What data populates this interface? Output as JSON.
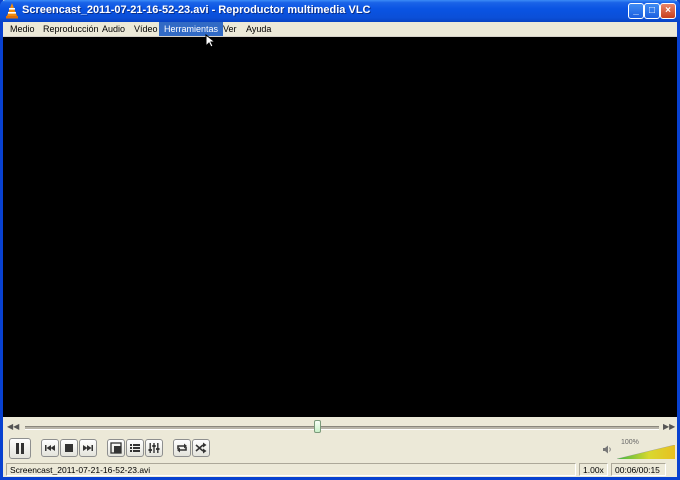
{
  "window": {
    "title": "Screencast_2011-07-21-16-52-23.avi - Reproductor multimedia VLC",
    "controls": {
      "minimize": "_",
      "maximize": "□",
      "close": "×"
    }
  },
  "menu": {
    "items": [
      {
        "label": "Medio",
        "active": false
      },
      {
        "label": "Reproducción",
        "active": false
      },
      {
        "label": "Audio",
        "active": false
      },
      {
        "label": "Vídeo",
        "active": false
      },
      {
        "label": "Herramientas",
        "active": true
      },
      {
        "label": "Ver",
        "active": false
      },
      {
        "label": "Ayuda",
        "active": false
      }
    ]
  },
  "seek": {
    "position_fraction": 0.46,
    "back_glyph": "◀◀",
    "forward_glyph": "▶▶"
  },
  "controls": {
    "buttons": [
      {
        "name": "pause-button",
        "icon": "pause-icon"
      },
      {
        "name": "previous-button",
        "icon": "skip-back-icon"
      },
      {
        "name": "stop-button",
        "icon": "stop-icon"
      },
      {
        "name": "next-button",
        "icon": "skip-forward-icon"
      },
      {
        "name": "fullscreen-button",
        "icon": "fullscreen-icon"
      },
      {
        "name": "playlist-button",
        "icon": "playlist-icon"
      },
      {
        "name": "extended-settings-button",
        "icon": "equalizer-icon"
      },
      {
        "name": "loop-button",
        "icon": "loop-icon"
      },
      {
        "name": "shuffle-button",
        "icon": "shuffle-icon"
      }
    ],
    "volume": {
      "label": "100%",
      "level": 1.0,
      "icon": "speaker-icon"
    }
  },
  "status": {
    "filename": "Screencast_2011-07-21-16-52-23.avi",
    "speed": "1.00x",
    "time": "00:06/00:15"
  },
  "colors": {
    "titlebar": "#0a54e3",
    "menu_active": "#316ac5",
    "video_bg": "#000000"
  }
}
